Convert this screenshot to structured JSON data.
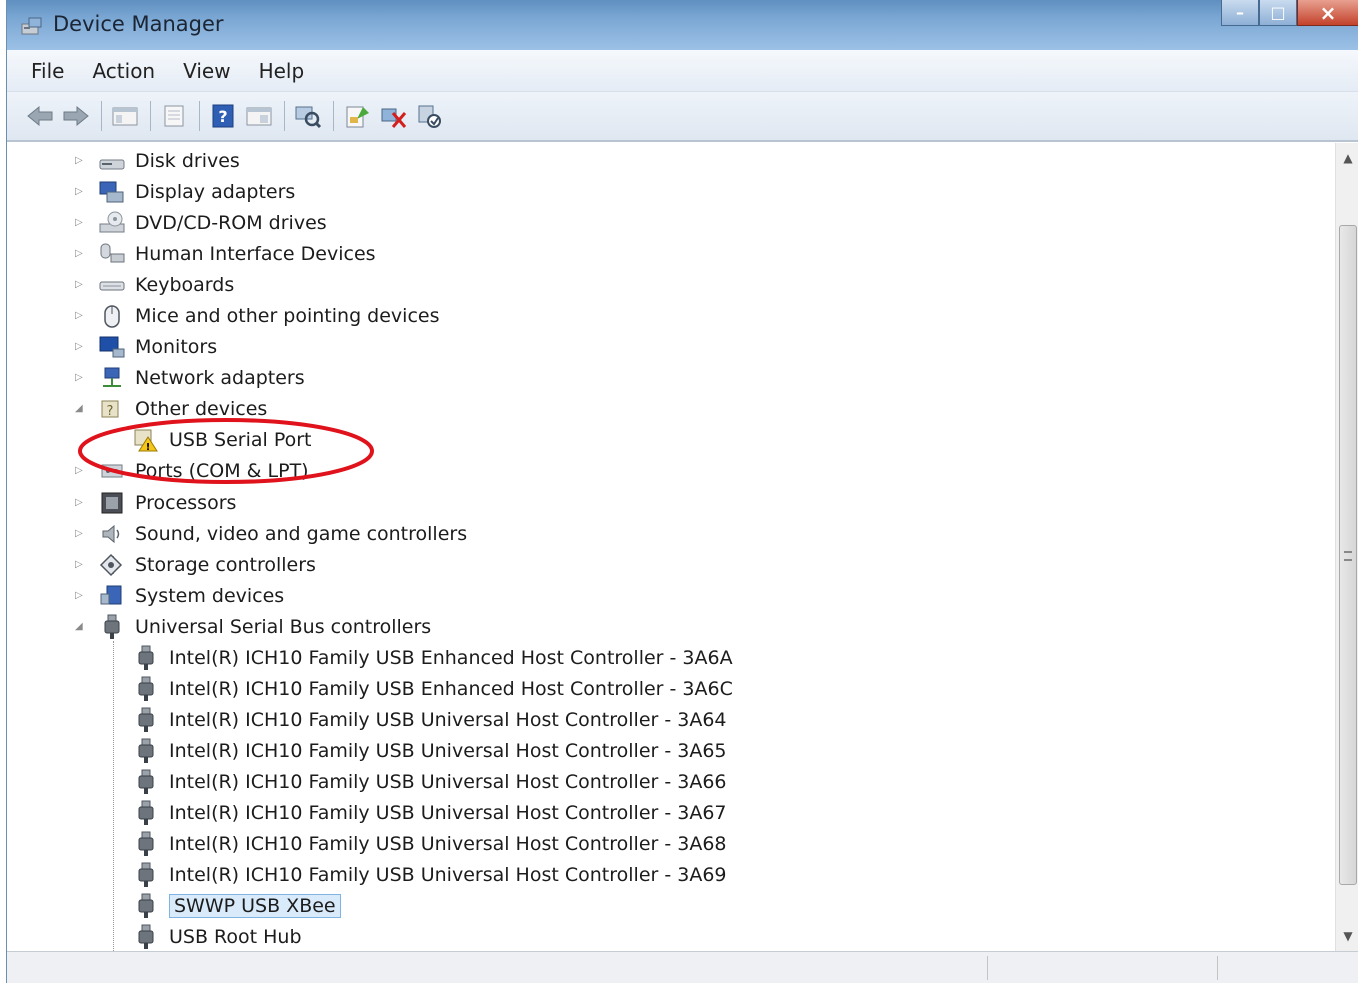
{
  "window": {
    "title": "Device Manager"
  },
  "menu": [
    "File",
    "Action",
    "View",
    "Help"
  ],
  "toolbar": [
    "back-icon",
    "forward-icon",
    "show-hide-console-tree-icon",
    "properties-icon",
    "help-icon",
    "view-icon",
    "scan-hardware-changes-icon",
    "update-driver-icon",
    "uninstall-icon",
    "disable-icon"
  ],
  "tree": {
    "categories": [
      {
        "label": "Disk drives"
      },
      {
        "label": "Display adapters"
      },
      {
        "label": "DVD/CD-ROM drives"
      },
      {
        "label": "Human Interface Devices"
      },
      {
        "label": "Keyboards"
      },
      {
        "label": "Mice and other pointing devices"
      },
      {
        "label": "Monitors"
      },
      {
        "label": "Network adapters"
      },
      {
        "label": "Other devices"
      },
      {
        "label": "Ports (COM & LPT)"
      },
      {
        "label": "Processors"
      },
      {
        "label": "Sound, video and game controllers"
      },
      {
        "label": "Storage controllers"
      },
      {
        "label": "System devices"
      },
      {
        "label": "Universal Serial Bus controllers"
      }
    ],
    "other_devices_children": [
      "USB Serial Port"
    ],
    "usb_children": [
      "Intel(R) ICH10 Family USB Enhanced Host Controller - 3A6A",
      "Intel(R) ICH10 Family USB Enhanced Host Controller - 3A6C",
      "Intel(R) ICH10 Family USB Universal Host Controller - 3A64",
      "Intel(R) ICH10 Family USB Universal Host Controller - 3A65",
      "Intel(R) ICH10 Family USB Universal Host Controller - 3A66",
      "Intel(R) ICH10 Family USB Universal Host Controller - 3A67",
      "Intel(R) ICH10 Family USB Universal Host Controller - 3A68",
      "Intel(R) ICH10 Family USB Universal Host Controller - 3A69",
      "SWWP USB XBee",
      "USB Root Hub"
    ],
    "selected": "SWWP USB XBee"
  },
  "colors": {
    "annotation": "#e0121b",
    "selection": "#d9ebfb",
    "titlebar": "#7aa6d3"
  }
}
